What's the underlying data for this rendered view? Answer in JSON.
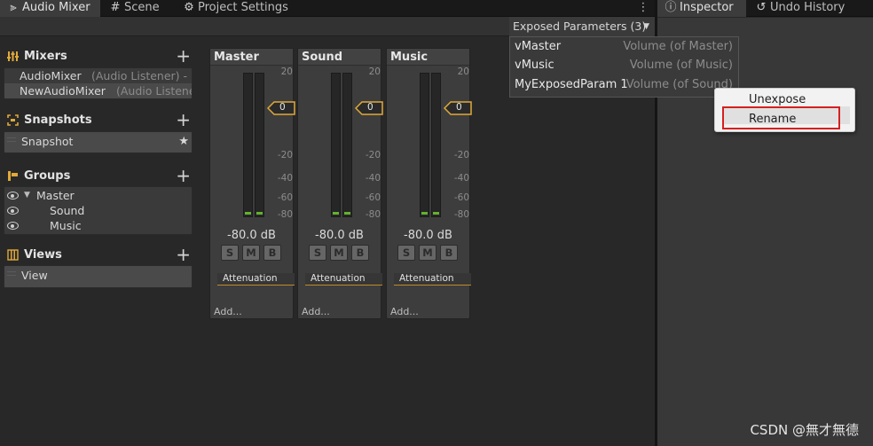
{
  "tabs_left": [
    {
      "label": "Audio Mixer",
      "icon": "sliders-icon",
      "active": true
    },
    {
      "label": "Scene",
      "icon": "hash-icon",
      "active": false
    },
    {
      "label": "Project Settings",
      "icon": "gear-icon",
      "active": false
    }
  ],
  "tabs_right": [
    {
      "label": "Inspector",
      "icon": "info-icon",
      "active": true
    },
    {
      "label": "Undo History",
      "icon": "history-icon",
      "active": false
    }
  ],
  "toolbar": {
    "exposed_button": "Exposed Parameters (3)"
  },
  "sidebar": {
    "mixers": {
      "title": "Mixers",
      "items": [
        {
          "name": "AudioMixer",
          "sub": "(Audio Listener) - I"
        },
        {
          "name": "NewAudioMixer",
          "sub": "(Audio Listene"
        }
      ]
    },
    "snapshots": {
      "title": "Snapshots",
      "items": [
        {
          "name": "Snapshot"
        }
      ]
    },
    "groups": {
      "title": "Groups",
      "items": [
        "Master",
        "Sound",
        "Music"
      ]
    },
    "views": {
      "title": "Views",
      "items": [
        "View"
      ]
    }
  },
  "strips": [
    {
      "name": "Master",
      "db": "-80.0 dB",
      "fader_value": "0",
      "effect": "Attenuation",
      "add": "Add..."
    },
    {
      "name": "Sound",
      "db": "-80.0 dB",
      "fader_value": "0",
      "effect": "Attenuation",
      "add": "Add..."
    },
    {
      "name": "Music",
      "db": "-80.0 dB",
      "fader_value": "0",
      "effect": "Attenuation",
      "add": "Add..."
    }
  ],
  "meter_ticks": [
    "20",
    "-20",
    "-40",
    "-60",
    "-80"
  ],
  "smb": [
    "S",
    "M",
    "B"
  ],
  "exposed_params": [
    {
      "name": "vMaster",
      "value": "Volume (of Master)"
    },
    {
      "name": "vMusic",
      "value": "Volume (of Music)"
    },
    {
      "name": "MyExposedParam 1",
      "value": "Volume (of Sound)"
    }
  ],
  "context_menu": {
    "items": [
      "Unexpose",
      "Rename"
    ]
  },
  "watermark": "CSDN @無才無德",
  "colors": {
    "accent": "#c08b2a",
    "meter_green": "#63b22f",
    "highlight": "#d61f1f"
  }
}
